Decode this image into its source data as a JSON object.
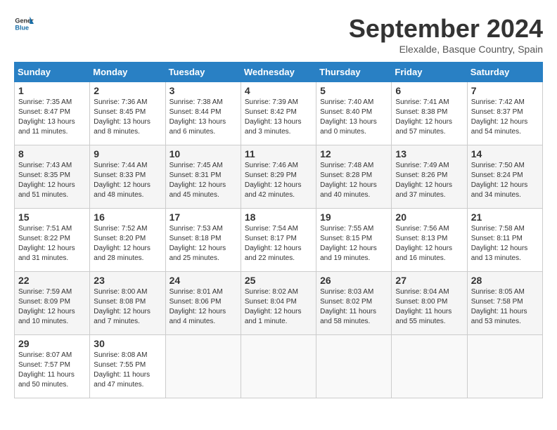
{
  "header": {
    "logo_general": "General",
    "logo_blue": "Blue",
    "title": "September 2024",
    "location": "Elexalde, Basque Country, Spain"
  },
  "days_of_week": [
    "Sunday",
    "Monday",
    "Tuesday",
    "Wednesday",
    "Thursday",
    "Friday",
    "Saturday"
  ],
  "weeks": [
    [
      {
        "day": "1",
        "sunrise": "7:35 AM",
        "sunset": "8:47 PM",
        "daylight": "13 hours and 11 minutes."
      },
      {
        "day": "2",
        "sunrise": "7:36 AM",
        "sunset": "8:45 PM",
        "daylight": "13 hours and 8 minutes."
      },
      {
        "day": "3",
        "sunrise": "7:38 AM",
        "sunset": "8:44 PM",
        "daylight": "13 hours and 6 minutes."
      },
      {
        "day": "4",
        "sunrise": "7:39 AM",
        "sunset": "8:42 PM",
        "daylight": "13 hours and 3 minutes."
      },
      {
        "day": "5",
        "sunrise": "7:40 AM",
        "sunset": "8:40 PM",
        "daylight": "13 hours and 0 minutes."
      },
      {
        "day": "6",
        "sunrise": "7:41 AM",
        "sunset": "8:38 PM",
        "daylight": "12 hours and 57 minutes."
      },
      {
        "day": "7",
        "sunrise": "7:42 AM",
        "sunset": "8:37 PM",
        "daylight": "12 hours and 54 minutes."
      }
    ],
    [
      {
        "day": "8",
        "sunrise": "7:43 AM",
        "sunset": "8:35 PM",
        "daylight": "12 hours and 51 minutes."
      },
      {
        "day": "9",
        "sunrise": "7:44 AM",
        "sunset": "8:33 PM",
        "daylight": "12 hours and 48 minutes."
      },
      {
        "day": "10",
        "sunrise": "7:45 AM",
        "sunset": "8:31 PM",
        "daylight": "12 hours and 45 minutes."
      },
      {
        "day": "11",
        "sunrise": "7:46 AM",
        "sunset": "8:29 PM",
        "daylight": "12 hours and 42 minutes."
      },
      {
        "day": "12",
        "sunrise": "7:48 AM",
        "sunset": "8:28 PM",
        "daylight": "12 hours and 40 minutes."
      },
      {
        "day": "13",
        "sunrise": "7:49 AM",
        "sunset": "8:26 PM",
        "daylight": "12 hours and 37 minutes."
      },
      {
        "day": "14",
        "sunrise": "7:50 AM",
        "sunset": "8:24 PM",
        "daylight": "12 hours and 34 minutes."
      }
    ],
    [
      {
        "day": "15",
        "sunrise": "7:51 AM",
        "sunset": "8:22 PM",
        "daylight": "12 hours and 31 minutes."
      },
      {
        "day": "16",
        "sunrise": "7:52 AM",
        "sunset": "8:20 PM",
        "daylight": "12 hours and 28 minutes."
      },
      {
        "day": "17",
        "sunrise": "7:53 AM",
        "sunset": "8:18 PM",
        "daylight": "12 hours and 25 minutes."
      },
      {
        "day": "18",
        "sunrise": "7:54 AM",
        "sunset": "8:17 PM",
        "daylight": "12 hours and 22 minutes."
      },
      {
        "day": "19",
        "sunrise": "7:55 AM",
        "sunset": "8:15 PM",
        "daylight": "12 hours and 19 minutes."
      },
      {
        "day": "20",
        "sunrise": "7:56 AM",
        "sunset": "8:13 PM",
        "daylight": "12 hours and 16 minutes."
      },
      {
        "day": "21",
        "sunrise": "7:58 AM",
        "sunset": "8:11 PM",
        "daylight": "12 hours and 13 minutes."
      }
    ],
    [
      {
        "day": "22",
        "sunrise": "7:59 AM",
        "sunset": "8:09 PM",
        "daylight": "12 hours and 10 minutes."
      },
      {
        "day": "23",
        "sunrise": "8:00 AM",
        "sunset": "8:08 PM",
        "daylight": "12 hours and 7 minutes."
      },
      {
        "day": "24",
        "sunrise": "8:01 AM",
        "sunset": "8:06 PM",
        "daylight": "12 hours and 4 minutes."
      },
      {
        "day": "25",
        "sunrise": "8:02 AM",
        "sunset": "8:04 PM",
        "daylight": "12 hours and 1 minute."
      },
      {
        "day": "26",
        "sunrise": "8:03 AM",
        "sunset": "8:02 PM",
        "daylight": "11 hours and 58 minutes."
      },
      {
        "day": "27",
        "sunrise": "8:04 AM",
        "sunset": "8:00 PM",
        "daylight": "11 hours and 55 minutes."
      },
      {
        "day": "28",
        "sunrise": "8:05 AM",
        "sunset": "7:58 PM",
        "daylight": "11 hours and 53 minutes."
      }
    ],
    [
      {
        "day": "29",
        "sunrise": "8:07 AM",
        "sunset": "7:57 PM",
        "daylight": "11 hours and 50 minutes."
      },
      {
        "day": "30",
        "sunrise": "8:08 AM",
        "sunset": "7:55 PM",
        "daylight": "11 hours and 47 minutes."
      },
      null,
      null,
      null,
      null,
      null
    ]
  ],
  "labels": {
    "sunrise": "Sunrise:",
    "sunset": "Sunset:",
    "daylight": "Daylight:"
  }
}
